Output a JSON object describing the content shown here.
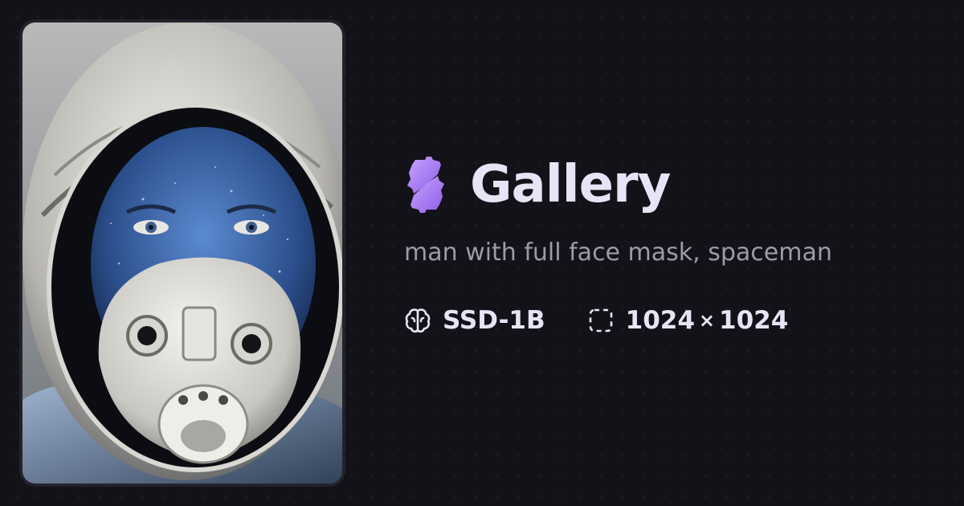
{
  "app": {
    "title": "Gallery",
    "logo_icon": "puzzle-gear-logo-icon",
    "accent_color": "#a77cf0"
  },
  "image": {
    "description_icon": "astronaut-photo"
  },
  "prompt": "man with full face mask, spaceman",
  "meta": {
    "model_icon": "brain-icon",
    "model": "SSD-1B",
    "size_icon": "dashed-square-icon",
    "width": "1024",
    "times": "×",
    "height": "1024"
  }
}
